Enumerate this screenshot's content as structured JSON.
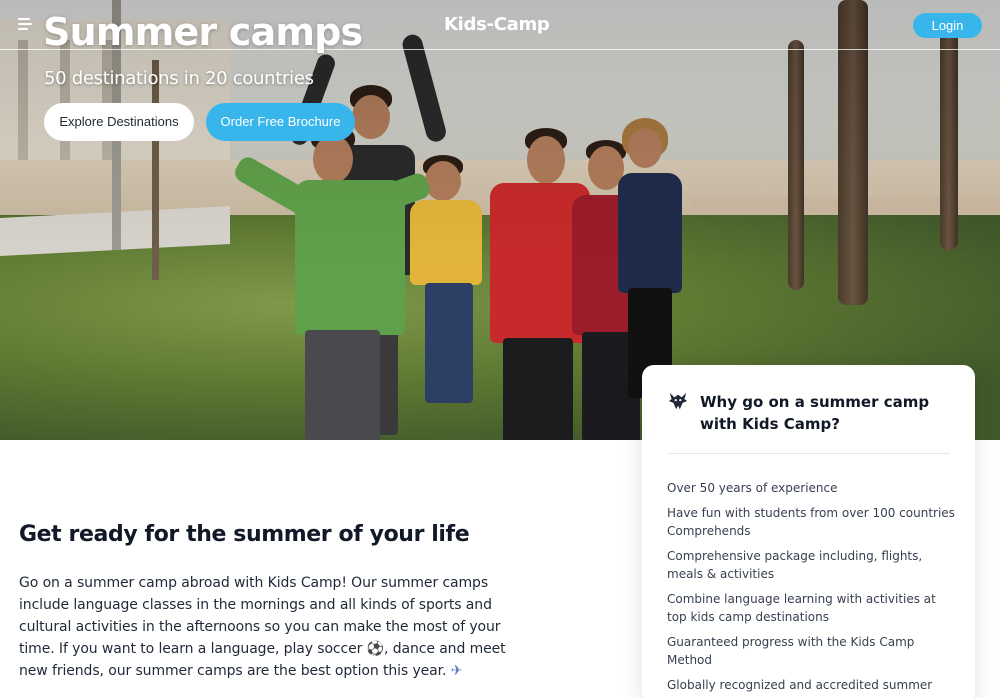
{
  "nav": {
    "logo": "Kids-Camp",
    "login_label": "Login",
    "menu_icon": "hamburger-menu-icon"
  },
  "hero": {
    "title": "Summer camps",
    "subtitle": "50 destinations in 20 countries",
    "explore_label": "Explore Destinations",
    "brochure_label": "Order Free Brochure"
  },
  "main": {
    "heading": "Get ready for the summer of your life",
    "body_1": "Go on a summer camp abroad with Kids Camp! Our summer camps include language classes in the mornings and all kinds of sports and cultural activities in the afternoons so you can make the most of your time. If you want to learn a language, play soccer ",
    "soccer_emoji": "⚽",
    "body_2": ", dance and meet new friends, our summer camps are the best option this year. ",
    "plane_emoji": "✈"
  },
  "card": {
    "icon": "wolf-logo-icon",
    "title": "Why go on a summer camp with Kids Camp?",
    "items": [
      "Over 50 years of experience",
      "Have fun with students from over 100 countries Comprehends",
      "Comprehensive package including, flights, meals & activities",
      "Combine language learning with activities at top kids camp destinations",
      "Guaranteed progress with the Kids Camp Method",
      "Globally recognized and accredited summer camps"
    ]
  },
  "colors": {
    "accent": "#38b6ec",
    "text_dark": "#111827"
  }
}
